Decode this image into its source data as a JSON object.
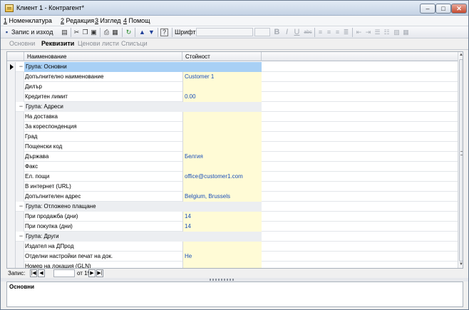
{
  "window": {
    "title": "Клиент 1 - Контрагент*",
    "minimize": "–",
    "maximize": "□",
    "close": "✕"
  },
  "menu": [
    {
      "key": "1",
      "label": " Номенклатура"
    },
    {
      "key": "2",
      "label": " Редакция"
    },
    {
      "key": "3",
      "label": " Изглед"
    },
    {
      "key": "4",
      "label": " Помощ"
    }
  ],
  "toolbar": {
    "save_label": "Запис и изход",
    "font_label": "Шрифт:",
    "bold": "B",
    "italic": "I",
    "underline": "U",
    "strike": "abc",
    "help": "?"
  },
  "tabs": [
    "Основни",
    "Реквизити",
    "Ценови листи",
    "Списъци"
  ],
  "grid": {
    "headers": {
      "name": "Наименование",
      "value": "Стойност"
    },
    "rows": [
      {
        "type": "group",
        "toggle": "−",
        "label": "Група: Основни"
      },
      {
        "type": "field",
        "label": "Допълнително наименование",
        "value": "Customer 1"
      },
      {
        "type": "field",
        "label": "Дилър",
        "value": ""
      },
      {
        "type": "field",
        "label": "Кредитен лимит",
        "value": "0.00"
      },
      {
        "type": "group",
        "toggle": "−",
        "label": "Група: Адреси"
      },
      {
        "type": "field",
        "label": "На доставка",
        "value": ""
      },
      {
        "type": "field",
        "label": "За кореспонденция",
        "value": ""
      },
      {
        "type": "field",
        "label": "Град",
        "value": ""
      },
      {
        "type": "field",
        "label": "Пощенски код",
        "value": ""
      },
      {
        "type": "field",
        "label": "Държава",
        "value": "Белгия"
      },
      {
        "type": "field",
        "label": "Факс",
        "value": ""
      },
      {
        "type": "field",
        "label": "Ел. пощи",
        "value": "office@customer1.com"
      },
      {
        "type": "field",
        "label": "В интернет (URL)",
        "value": ""
      },
      {
        "type": "field",
        "label": "Допълнителен адрес",
        "value": "Belgium, Brussels"
      },
      {
        "type": "group",
        "toggle": "−",
        "label": "Група: Отложено плащане"
      },
      {
        "type": "field",
        "label": "При продажба (дни)",
        "value": "14"
      },
      {
        "type": "field",
        "label": "При покупка (дни)",
        "value": "14"
      },
      {
        "type": "group",
        "toggle": "−",
        "label": "Група: Други"
      },
      {
        "type": "field",
        "label": "Издател на ДПрод",
        "value": ""
      },
      {
        "type": "field",
        "label": "Отделни настройки печат на док.",
        "value": "Не"
      },
      {
        "type": "field",
        "label": "Номер на локация (GLN)",
        "value": ""
      }
    ]
  },
  "navigator": {
    "label": "Запис:",
    "current": "",
    "of_label": "от 19"
  },
  "bottom_panel": {
    "title": "Основни"
  }
}
